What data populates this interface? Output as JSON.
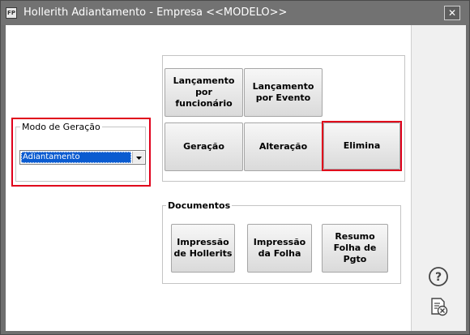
{
  "window": {
    "app_icon_text": "FP",
    "title": "Hollerith Adiantamento - Empresa <<MODELO>>",
    "close_symbol": "✕"
  },
  "mode": {
    "legend": "Modo de Geração",
    "selected": "Adiantamento"
  },
  "actions": {
    "lancamento_funcionario": "Lançamento por funcionário",
    "lancamento_evento": "Lançamento por Evento",
    "geracao": "Geração",
    "alteracao": "Alteração",
    "elimina": "Elimina"
  },
  "documentos": {
    "title": "Documentos",
    "impressao_hollerits": "Impressão de Hollerits",
    "impressao_folha": "Impressão da Folha",
    "resumo_folha": "Resumo Folha de Pgto"
  },
  "sidebar": {
    "help_icon": "help-icon",
    "exit_icon": "exit-document-icon"
  },
  "colors": {
    "highlight": "#e0001b",
    "title_bar": "#727272",
    "selection": "#0a5bd0"
  }
}
